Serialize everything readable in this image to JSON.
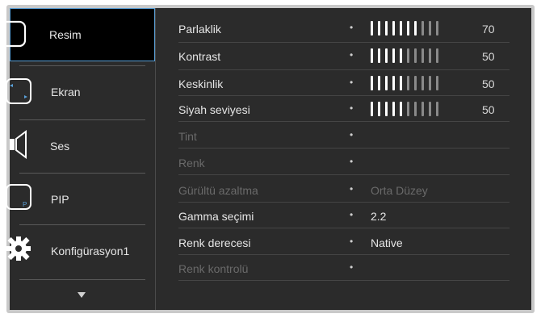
{
  "sidebar": {
    "items": [
      {
        "label": "Resim",
        "icon": "picture-icon",
        "active": true
      },
      {
        "label": "Ekran",
        "icon": "screen-icon",
        "active": false
      },
      {
        "label": "Ses",
        "icon": "speaker-icon",
        "active": false
      },
      {
        "label": "PIP",
        "icon": "pip-icon",
        "active": false
      },
      {
        "label": "Konfigürasyon1",
        "icon": "gear-icon",
        "active": false
      }
    ],
    "more_icon": "chevron-down-icon"
  },
  "settings": [
    {
      "label": "Parlaklik",
      "enabled": true,
      "type": "slider",
      "value": 70,
      "bars_lit": 7,
      "bars_total": 10
    },
    {
      "label": "Kontrast",
      "enabled": true,
      "type": "slider",
      "value": 50,
      "bars_lit": 5,
      "bars_total": 10
    },
    {
      "label": "Keskinlik",
      "enabled": true,
      "type": "slider",
      "value": 50,
      "bars_lit": 5,
      "bars_total": 10
    },
    {
      "label": "Siyah seviyesi",
      "enabled": true,
      "type": "slider",
      "value": 50,
      "bars_lit": 5,
      "bars_total": 10
    },
    {
      "label": "Tint",
      "enabled": false,
      "type": "text",
      "value": ""
    },
    {
      "label": "Renk",
      "enabled": false,
      "type": "text",
      "value": ""
    },
    {
      "label": "Gürültü azaltma",
      "enabled": false,
      "type": "text",
      "value": "Orta Düzey"
    },
    {
      "label": "Gamma seçimi",
      "enabled": true,
      "type": "text",
      "value": "2.2"
    },
    {
      "label": "Renk derecesi",
      "enabled": true,
      "type": "text",
      "value": "Native"
    },
    {
      "label": "Renk kontrolü",
      "enabled": false,
      "type": "text",
      "value": ""
    }
  ],
  "colors": {
    "background": "#2b2b2b",
    "active_border": "#5aa0d8",
    "bar_lit": "#ffffff",
    "bar_dim": "#8a8a8a",
    "text_enabled": "#e6e6e6",
    "text_disabled": "#6a6a6a"
  }
}
